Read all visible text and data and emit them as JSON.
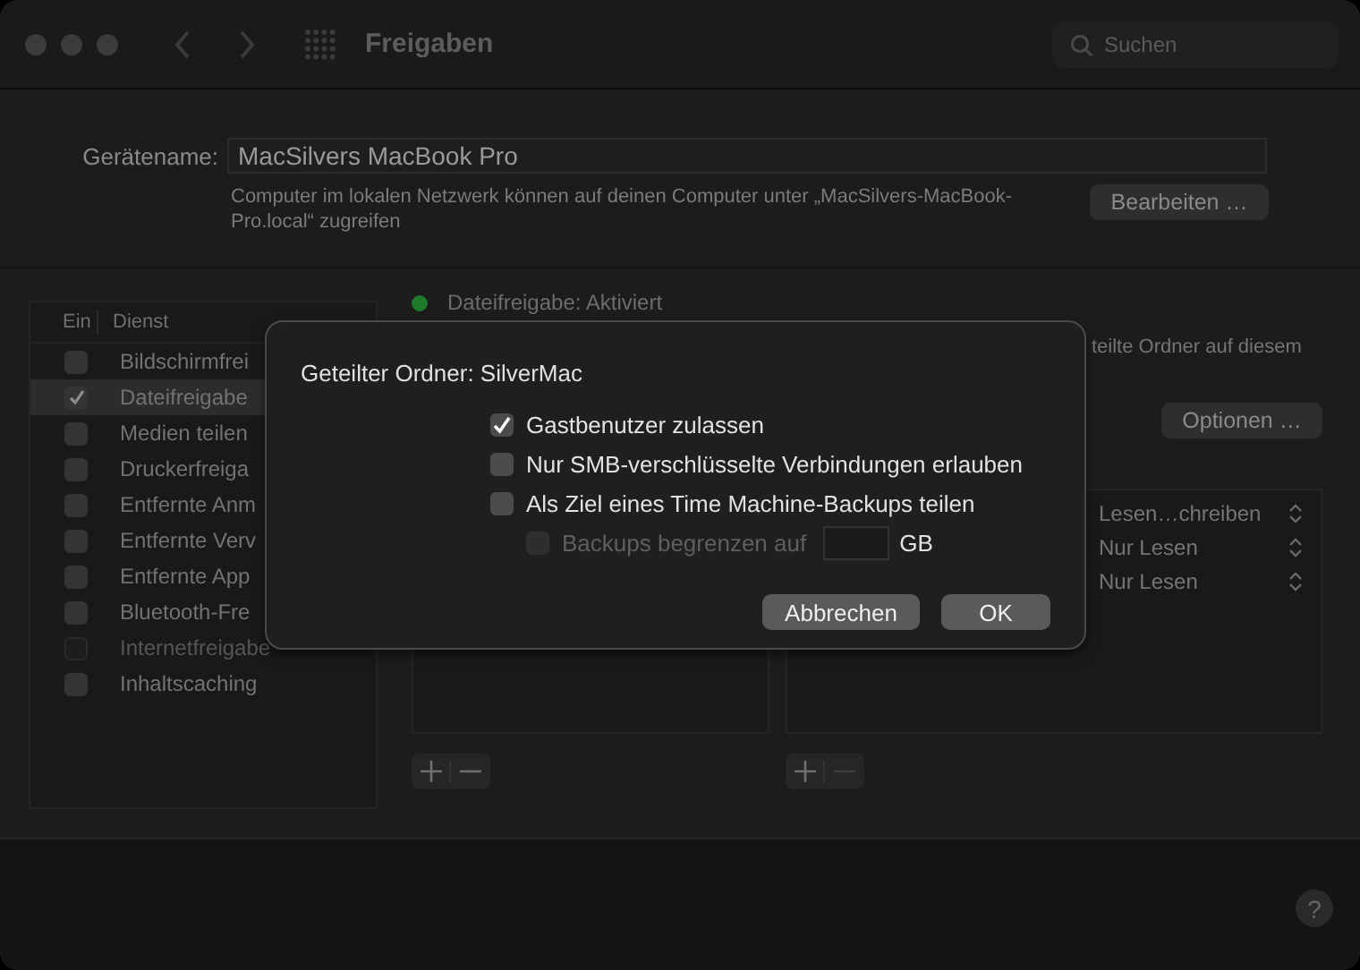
{
  "window": {
    "title": "Freigaben",
    "search": {
      "placeholder": "Suchen"
    }
  },
  "device_name": {
    "label": "Gerätename:",
    "value": "MacSilvers MacBook Pro",
    "note": "Computer im lokalen Netzwerk können auf deinen Computer unter „MacSilvers-MacBook-Pro.local“ zugreifen",
    "button": "Bearbeiten …"
  },
  "services": {
    "columns": [
      "Ein",
      "Dienst"
    ],
    "rows": [
      {
        "name": "Bildschirmfrei",
        "checked": false,
        "selected": false,
        "disabled": false
      },
      {
        "name": "Dateifreigabe",
        "checked": true,
        "selected": true,
        "disabled": false
      },
      {
        "name": "Medien teilen",
        "checked": false,
        "selected": false,
        "disabled": false
      },
      {
        "name": "Druckerfreiga",
        "checked": false,
        "selected": false,
        "disabled": false
      },
      {
        "name": "Entfernte Anm",
        "checked": false,
        "selected": false,
        "disabled": false
      },
      {
        "name": "Entfernte Verv",
        "checked": false,
        "selected": false,
        "disabled": false
      },
      {
        "name": "Entfernte App",
        "checked": false,
        "selected": false,
        "disabled": false
      },
      {
        "name": "Bluetooth-Fre",
        "checked": false,
        "selected": false,
        "disabled": false
      },
      {
        "name": "Internetfreigabe",
        "checked": false,
        "selected": false,
        "disabled": true
      },
      {
        "name": "Inhaltscaching",
        "checked": false,
        "selected": false,
        "disabled": false
      }
    ]
  },
  "status": {
    "text": "Dateifreigabe: Aktiviert",
    "on": true
  },
  "description": "teilte Ordner auf diesem",
  "options_button": "Optionen …",
  "folder_list": {
    "remove_disabled": false
  },
  "user_list": {
    "rows": [
      {
        "permission": "Lesen…chreiben"
      },
      {
        "permission": "Nur Lesen"
      },
      {
        "permission": "Nur Lesen"
      }
    ],
    "remove_disabled": true
  },
  "help": "?",
  "sheet": {
    "title": "Geteilter Ordner: SilverMac",
    "options": [
      {
        "kind": "checkbox",
        "label": "Gastbenutzer zulassen",
        "checked": true,
        "disabled": false
      },
      {
        "kind": "checkbox",
        "label": "Nur SMB-verschlüsselte Verbindungen erlauben",
        "checked": false,
        "disabled": false
      },
      {
        "kind": "checkbox",
        "label": "Als Ziel eines Time Machine-Backups teilen",
        "checked": false,
        "disabled": false
      },
      {
        "kind": "limit",
        "label": "Backups begrenzen auf",
        "unit": "GB",
        "checked": false,
        "disabled": true
      }
    ],
    "buttons": [
      "Abbrechen",
      "OK"
    ]
  }
}
